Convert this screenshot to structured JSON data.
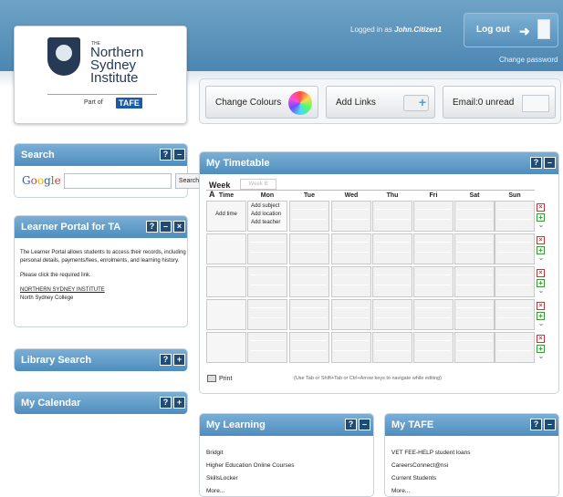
{
  "header": {
    "logged_in_prefix": "Logged in as",
    "username": "John.Citizen1",
    "logout_label": "Log out",
    "change_password": "Change password",
    "brand_color": "#4f8dbd"
  },
  "logo": {
    "the": "THE",
    "line1": "Northern",
    "line2": "Sydney",
    "line3": "Institute",
    "part_of": "Part of",
    "tafe": "TAFE"
  },
  "toolbar": {
    "change_colours": "Change Colours",
    "add_links": "Add Links",
    "email": "Email:0 unread"
  },
  "search": {
    "title": "Search",
    "google": [
      "G",
      "o",
      "o",
      "g",
      "l",
      "e"
    ],
    "button": "Search",
    "input_value": ""
  },
  "learner_portal": {
    "title": "Learner Portal for TA",
    "p1": "The Learner Portal allows students to access their records, including personal details, payments/fees, enrolments, and learning history.",
    "p2": "Please click the required link.",
    "link1": "NORTHERN SYDNEY INSTITUTE",
    "link2": "North Sydney College"
  },
  "library_search": {
    "title": "Library Search"
  },
  "my_calendar": {
    "title": "My Calendar"
  },
  "panel_buttons": {
    "help": "?",
    "minimize": "–",
    "expand": "+",
    "close": "×"
  },
  "timetable": {
    "title": "My Timetable",
    "tab_a": "Week A",
    "tab_b": "Week B",
    "time_header": "Time",
    "days": [
      "Mon",
      "Tue",
      "Wed",
      "Thu",
      "Fri",
      "Sat",
      "Sun"
    ],
    "add_time": "Add time",
    "add_subject": "Add subject",
    "add_location": "Add location",
    "add_teacher": "Add teacher",
    "print": "Print",
    "hint": "(Use Tab or Shift+Tab or Ctrl+Arrow keys to navigate while editing)"
  },
  "my_learning": {
    "title": "My Learning",
    "items": [
      "Bridgit",
      "Higher Education Online Courses",
      "SkillsLocker",
      "More..."
    ]
  },
  "my_tafe": {
    "title": "My TAFE",
    "items": [
      "VET FEE-HELP student loans",
      "CareersConnect@nsi",
      "Current Students",
      "More..."
    ]
  }
}
